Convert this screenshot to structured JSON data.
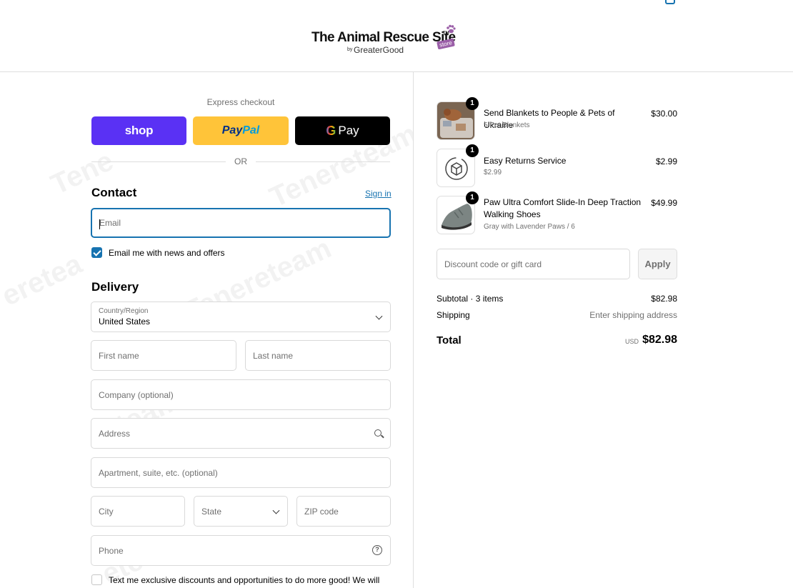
{
  "brand": {
    "name": "The Animal Rescue Site",
    "tm": "TM",
    "by": "by",
    "parent": "GreaterGood",
    "store_tag": "store"
  },
  "express": {
    "title": "Express checkout",
    "shop_label": "shop",
    "paypal_a": "Pay",
    "paypal_b": "Pal",
    "gpay_g": "G",
    "gpay_label": "Pay",
    "or": "OR"
  },
  "contact": {
    "title": "Contact",
    "signin": "Sign in",
    "email_placeholder": "Email",
    "newsletter_label": "Email me with news and offers",
    "newsletter_checked": true
  },
  "delivery": {
    "title": "Delivery",
    "country_label": "Country/Region",
    "country_value": "United States",
    "first_name": "First name",
    "last_name": "Last name",
    "company": "Company (optional)",
    "address": "Address",
    "apartment": "Apartment, suite, etc. (optional)",
    "city": "City",
    "state": "State",
    "zip": "ZIP code",
    "phone": "Phone",
    "help_glyph": "?",
    "sms_label": "Text me exclusive discounts and opportunities to do more good! We will",
    "sms_checked": false
  },
  "order": {
    "items": [
      {
        "qty": "1",
        "name": "Send Blankets to People & Pets of Ukraine",
        "sub": "5 Pet Blankets",
        "price": "$30.00"
      },
      {
        "qty": "1",
        "name": "Easy Returns Service",
        "sub": "$2.99",
        "price": "$2.99"
      },
      {
        "qty": "1",
        "name": "Paw Ultra Comfort Slide-In Deep Traction Walking Shoes",
        "sub": "Gray with Lavender Paws / 6",
        "price": "$49.99"
      }
    ],
    "discount_placeholder": "Discount code or gift card",
    "apply_label": "Apply",
    "subtotal_label": "Subtotal · 3 items",
    "subtotal_value": "$82.98",
    "shipping_label": "Shipping",
    "shipping_value": "Enter shipping address",
    "total_label": "Total",
    "currency": "USD",
    "total_value": "$82.98"
  },
  "colors": {
    "accent": "#1773b0",
    "shop": "#5a31f4",
    "paypal": "#ffc439",
    "gpay": "#000000"
  }
}
